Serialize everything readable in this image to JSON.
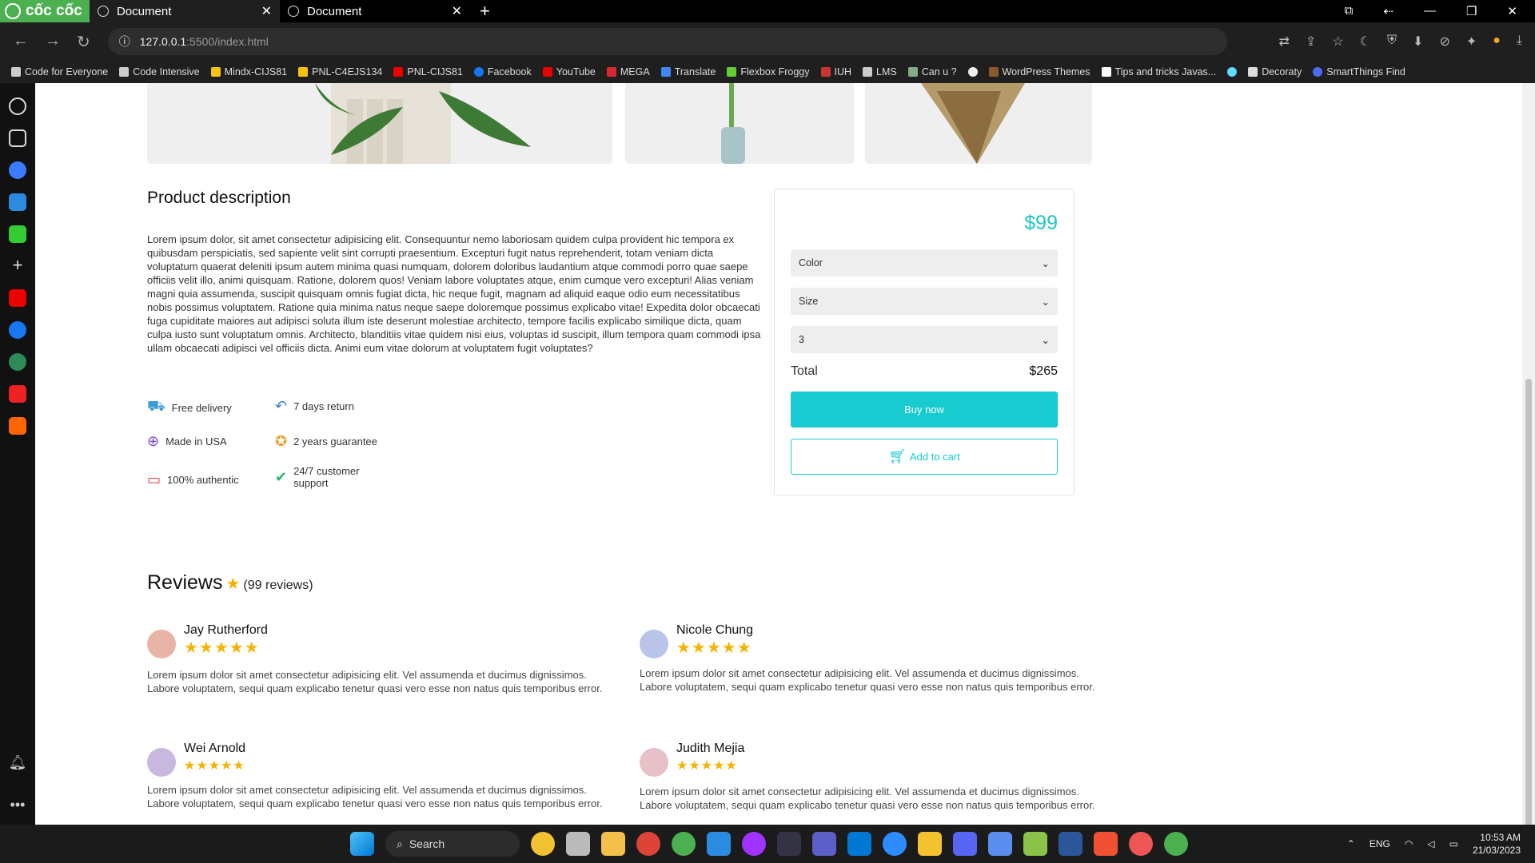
{
  "browser": {
    "logo_text": "cốc cốc",
    "tabs": [
      {
        "title": "Document"
      },
      {
        "title": "Document"
      }
    ],
    "url_host": "127.0.0.1",
    "url_path": ":5500/index.html",
    "bookmarks": [
      "Code for Everyone",
      "Code Intensive",
      "Mindx-CIJS81",
      "PNL-C4EJS134",
      "PNL-CIJS81",
      "Facebook",
      "YouTube",
      "MEGA",
      "Translate",
      "Flexbox Froggy",
      "IUH",
      "LMS",
      "Can u ?",
      "WordPress Themes",
      "Tips and tricks Javas...",
      "Decoraty",
      "SmartThings Find"
    ]
  },
  "product": {
    "description_title": "Product description",
    "description": "Lorem ipsum dolor, sit amet consectetur adipisicing elit. Consequuntur nemo laboriosam quidem culpa provident hic tempora ex quibusdam perspiciatis, sed sapiente velit sint corrupti praesentium. Excepturi fugit natus reprehenderit, totam veniam dicta voluptatum quaerat deleniti ipsum autem minima quasi numquam, dolorem doloribus laudantium atque commodi porro quae saepe officiis velit illo, animi quisquam. Ratione, dolorem quos! Veniam labore voluptates atque, enim cumque vero excepturi! Alias veniam magni quia assumenda, suscipit quisquam omnis fugiat dicta, hic neque fugit, magnam ad aliquid eaque odio eum necessitatibus nobis possimus voluptatem. Ratione quia minima natus neque saepe doloremque possimus explicabo vitae! Expedita dolor obcaecati fuga cupiditate maiores aut adipisci soluta illum iste deserunt molestiae architecto, tempore facilis explicabo similique dicta, quam culpa iusto sunt voluptatum omnis. Architecto, blanditiis vitae quidem nisi eius, voluptas id suscipit, illum tempora quam commodi ipsa ullam obcaecati adipisci vel officiis dicta. Animi eum vitae dolorum at voluptatem fugit voluptates?",
    "features": {
      "free_delivery": "Free delivery",
      "return": "7 days return",
      "made_in": "Made in USA",
      "guarantee": "2 years guarantee",
      "authentic": "100% authentic",
      "support": "24/7 customer support"
    },
    "price": "$99",
    "color_select": "Color",
    "size_select": "Size",
    "quantity_select": "3",
    "total_label": "Total",
    "total_value": "$265",
    "buy_label": "Buy now",
    "cart_label": "Add to cart"
  },
  "reviews": {
    "title": "Reviews",
    "count_text": "(99 reviews)",
    "items": [
      {
        "name": "Jay Rutherford",
        "stars": "★★★★★",
        "text": "Lorem ipsum dolor sit amet consectetur adipisicing elit. Vel assumenda et ducimus dignissimos. Labore voluptatem, sequi quam explicabo tenetur quasi vero esse non natus quis temporibus error.",
        "avatar_color": "#e8b4a8"
      },
      {
        "name": "Nicole Chung",
        "stars": "★★★★★",
        "text": "Lorem ipsum dolor sit amet consectetur adipisicing elit. Vel assumenda et ducimus dignissimos. Labore voluptatem, sequi quam explicabo tenetur quasi vero esse non natus quis temporibus error.",
        "avatar_color": "#b8c4e8"
      },
      {
        "name": "Wei Arnold",
        "stars": "★★★★★",
        "text": "Lorem ipsum dolor sit amet consectetur adipisicing elit. Vel assumenda et ducimus dignissimos. Labore voluptatem, sequi quam explicabo tenetur quasi vero esse non natus quis temporibus error.",
        "avatar_color": "#c8b8e0"
      },
      {
        "name": "Judith Mejia",
        "stars": "★★★★★",
        "text": "Lorem ipsum dolor sit amet consectetur adipisicing elit. Vel assumenda et ducimus dignissimos. Labore voluptatem, sequi quam explicabo tenetur quasi vero esse non natus quis temporibus error.",
        "avatar_color": "#e8c0c8"
      }
    ]
  },
  "taskbar": {
    "search_label": "Search",
    "lang": "ENG",
    "time": "10:53 AM",
    "date": "21/03/2023"
  },
  "colors": {
    "accent": "#17cbd0",
    "star": "#f5b301"
  }
}
